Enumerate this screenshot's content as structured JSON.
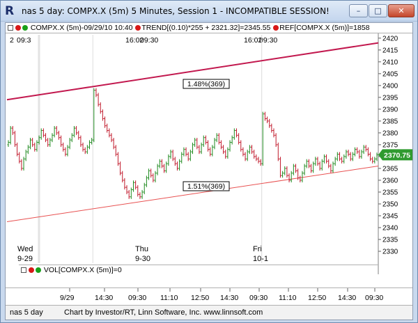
{
  "window": {
    "title": "nas 5 day: COMPX.X (5m) 5 Minutes, Session 1 - INCOMPATIBLE SESSION!",
    "min_label": "–",
    "max_label": "□",
    "close_label": "✕"
  },
  "info_bar": {
    "title_item": "COMPX.X (5m)-09/29/10 10:40",
    "trend_item": "TREND[(0.10)*255 + 2321.32]=2345.55",
    "ref_item": "REF[COMPX.X (5m)]=1858"
  },
  "top_time_labels": [
    {
      "text": "2",
      "at": "left-edge"
    },
    {
      "text": "09:3"
    },
    {
      "text": "16:02"
    },
    {
      "text": "09:30"
    },
    {
      "text": "16:02"
    },
    {
      "text": "09:30"
    }
  ],
  "annotations": {
    "upper_label": "1.48%(369)",
    "lower_label": "1.51%(369)"
  },
  "price_badge": "2370.75",
  "day_labels": [
    {
      "day": "Wed",
      "date": "9-29"
    },
    {
      "day": "Thu",
      "date": "9-30"
    },
    {
      "day": "Fri",
      "date": "10-1"
    }
  ],
  "volume_bar": {
    "label": "VOL[COMPX.X (5m)]=0"
  },
  "bottom_time_labels": [
    "9/29",
    "14:30",
    "09:30",
    "11:10",
    "12:50",
    "14:30",
    "09:30",
    "11:10",
    "12:50",
    "14:30",
    "09:30"
  ],
  "footer": {
    "left": "nas 5 day",
    "right": "Chart by Investor/RT, Linn Software, Inc. www.linnsoft.com"
  },
  "colors": {
    "bar_up": "#1f8a1f",
    "bar_down": "#c0182a",
    "upper_trend": "#c2184e",
    "lower_trend": "#e85050",
    "badge": "#2f9a2f"
  },
  "chart_data": {
    "type": "bar",
    "title": "COMPX.X (5m)",
    "xlabel": "",
    "ylabel": "",
    "ylim": [
      2325,
      2422
    ],
    "y_ticks": [
      2330,
      2335,
      2340,
      2345,
      2350,
      2355,
      2360,
      2365,
      2370,
      2375,
      2380,
      2385,
      2390,
      2395,
      2400,
      2405,
      2410,
      2415,
      2420
    ],
    "y_tick_labels": [
      "2330",
      "2335",
      "2340",
      "2345",
      "2350",
      "2355",
      "2360",
      "2365",
      "2370",
      "2375",
      "2380",
      "2385",
      "2390",
      "2395",
      "2400",
      "2405",
      "2410",
      "2415",
      "2420"
    ],
    "sessions": [
      {
        "day": "Wed",
        "start_index": 0,
        "end_index": 38
      },
      {
        "day": "Thu",
        "start_index": 39,
        "end_index": 115
      },
      {
        "day": "Fri",
        "start_index": 116,
        "end_index": 168
      }
    ],
    "trendlines": [
      {
        "name": "upper",
        "label": "1.48%(369)",
        "start": {
          "index": 0,
          "value": 2394
        },
        "end": {
          "index": 168,
          "value": 2418
        }
      },
      {
        "name": "lower",
        "label": "1.51%(369)",
        "start": {
          "index": 0,
          "value": 2342.5
        },
        "end": {
          "index": 168,
          "value": 2366
        }
      }
    ],
    "close_series": [
      2376,
      2382,
      2380,
      2375,
      2371,
      2368,
      2365,
      2369,
      2372,
      2374,
      2377,
      2375,
      2373,
      2376,
      2378,
      2381,
      2379,
      2377,
      2375,
      2377,
      2379,
      2382,
      2380,
      2378,
      2375,
      2373,
      2371,
      2374,
      2377,
      2379,
      2382,
      2380,
      2378,
      2375,
      2373,
      2372,
      2374,
      2376,
      2377,
      2398,
      2396,
      2392,
      2389,
      2386,
      2383,
      2381,
      2379,
      2377,
      2374,
      2371,
      2367,
      2363,
      2360,
      2357,
      2355,
      2353,
      2356,
      2359,
      2357,
      2354,
      2353,
      2355,
      2358,
      2361,
      2364,
      2362,
      2360,
      2363,
      2366,
      2368,
      2366,
      2364,
      2367,
      2370,
      2372,
      2369,
      2367,
      2365,
      2368,
      2371,
      2373,
      2371,
      2369,
      2372,
      2375,
      2377,
      2374,
      2372,
      2375,
      2378,
      2376,
      2373,
      2371,
      2374,
      2377,
      2379,
      2376,
      2374,
      2372,
      2370,
      2373,
      2376,
      2378,
      2381,
      2379,
      2376,
      2373,
      2371,
      2369,
      2372,
      2374,
      2372,
      2370,
      2369,
      2368,
      2367,
      2388,
      2386,
      2385,
      2383,
      2381,
      2379,
      2375,
      2369,
      2362,
      2363,
      2365,
      2362,
      2360,
      2363,
      2366,
      2364,
      2361,
      2360,
      2363,
      2366,
      2368,
      2366,
      2364,
      2367,
      2369,
      2367,
      2365,
      2368,
      2370,
      2368,
      2366,
      2364,
      2367,
      2369,
      2371,
      2369,
      2368,
      2370,
      2372,
      2371,
      2369,
      2371,
      2373,
      2372,
      2370,
      2372,
      2374,
      2373,
      2371,
      2369,
      2368,
      2369,
      2370.75
    ]
  }
}
